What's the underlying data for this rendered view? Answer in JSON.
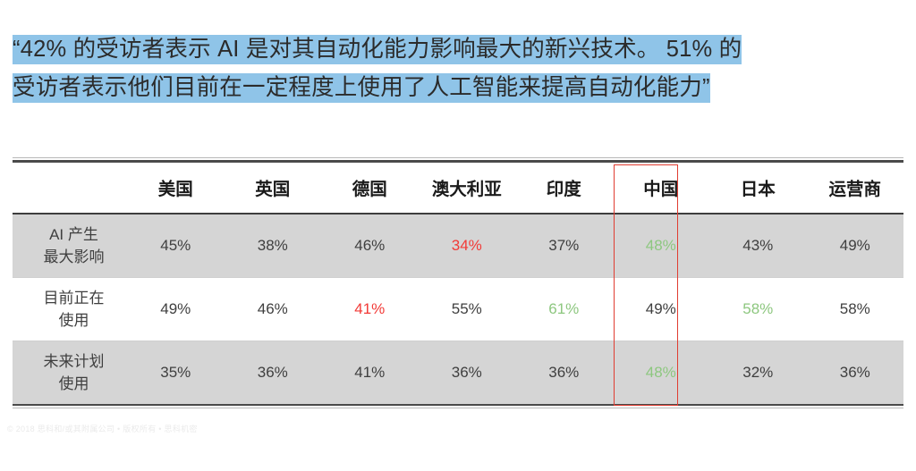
{
  "quote": {
    "line1": "“42% 的受访者表示 AI 是对其自动化能力影响最大的新兴技术。 51% 的",
    "line2": "受访者表示他们目前在一定程度上使用了人工智能来提高自动化能力”",
    "highlight_color": "#8fc4e8"
  },
  "footer": {
    "text": "© 2018 思科和/或其附属公司 • 版权所有 • 思科机密"
  },
  "chart_data": {
    "type": "table",
    "title": "",
    "highlight_column": "中国",
    "highlight_box_color": "#e03c31",
    "colors": {
      "low_value": "#f23a37",
      "high_value": "#8dc77f",
      "normal_value": "#3f3f3f",
      "shaded_row": "#d5d5d5"
    },
    "row_label_header": "",
    "categories": [
      "美国",
      "英国",
      "德国",
      "澳大利亚",
      "印度",
      "中国",
      "日本",
      "运营商"
    ],
    "rows": [
      {
        "label_line1": "AI 产生",
        "label_line2": "最大影响",
        "shaded": true,
        "cells": [
          {
            "value": "45%",
            "tone": "normal"
          },
          {
            "value": "38%",
            "tone": "normal"
          },
          {
            "value": "46%",
            "tone": "normal"
          },
          {
            "value": "34%",
            "tone": "low"
          },
          {
            "value": "37%",
            "tone": "normal"
          },
          {
            "value": "48%",
            "tone": "high"
          },
          {
            "value": "43%",
            "tone": "normal"
          },
          {
            "value": "49%",
            "tone": "normal"
          }
        ]
      },
      {
        "label_line1": "目前正在",
        "label_line2": "使用",
        "shaded": false,
        "cells": [
          {
            "value": "49%",
            "tone": "normal"
          },
          {
            "value": "46%",
            "tone": "normal"
          },
          {
            "value": "41%",
            "tone": "low"
          },
          {
            "value": "55%",
            "tone": "normal"
          },
          {
            "value": "61%",
            "tone": "high"
          },
          {
            "value": "49%",
            "tone": "normal"
          },
          {
            "value": "58%",
            "tone": "high"
          },
          {
            "value": "58%",
            "tone": "normal"
          }
        ]
      },
      {
        "label_line1": "未来计划",
        "label_line2": "使用",
        "shaded": true,
        "cells": [
          {
            "value": "35%",
            "tone": "normal"
          },
          {
            "value": "36%",
            "tone": "normal"
          },
          {
            "value": "41%",
            "tone": "normal"
          },
          {
            "value": "36%",
            "tone": "normal"
          },
          {
            "value": "36%",
            "tone": "normal"
          },
          {
            "value": "48%",
            "tone": "high"
          },
          {
            "value": "32%",
            "tone": "normal"
          },
          {
            "value": "36%",
            "tone": "normal"
          }
        ]
      }
    ]
  }
}
